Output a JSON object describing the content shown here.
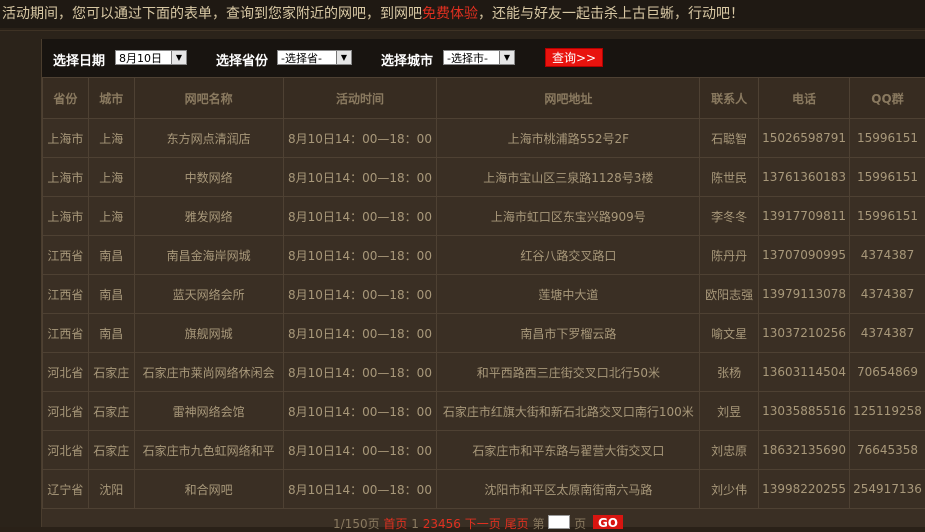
{
  "notice": {
    "before": "活动期间，您可以通过下面的表单，查询到您家附近的网吧，到网吧",
    "highlight": "免费体验",
    "after": "，还能与好友一起击杀上古巨蜥，行动吧！"
  },
  "filters": {
    "date_label": "选择日期",
    "date_value": "8月10日",
    "province_label": "选择省份",
    "province_value": "-选择省-",
    "city_label": "选择城市",
    "city_value": "-选择市-",
    "query_button": "查询>>"
  },
  "table": {
    "headers": [
      "省份",
      "城市",
      "网吧名称",
      "活动时间",
      "网吧地址",
      "联系人",
      "电话",
      "QQ群"
    ],
    "rows": [
      [
        "上海市",
        "上海",
        "东方网点清润店",
        "8月10日14：00—18：00",
        "上海市桃浦路552号2F",
        "石聪智",
        "15026598791",
        "15996151"
      ],
      [
        "上海市",
        "上海",
        "中数网络",
        "8月10日14：00—18：00",
        "上海市宝山区三泉路1128号3楼",
        "陈世民",
        "13761360183",
        "15996151"
      ],
      [
        "上海市",
        "上海",
        "雅发网络",
        "8月10日14：00—18：00",
        "上海市虹口区东宝兴路909号",
        "李冬冬",
        "13917709811",
        "15996151"
      ],
      [
        "江西省",
        "南昌",
        "南昌金海岸网城",
        "8月10日14：00—18：00",
        "红谷八路交叉路口",
        "陈丹丹",
        "13707090995",
        "4374387"
      ],
      [
        "江西省",
        "南昌",
        "蓝天网络会所",
        "8月10日14：00—18：00",
        "莲塘中大道",
        "欧阳志强",
        "13979113078",
        "4374387"
      ],
      [
        "江西省",
        "南昌",
        "旗舰网城",
        "8月10日14：00—18：00",
        "南昌市下罗榴云路",
        "喻文星",
        "13037210256",
        "4374387"
      ],
      [
        "河北省",
        "石家庄",
        "石家庄市莱尚网络休闲会",
        "8月10日14：00—18：00",
        "和平西路西三庄街交叉口北行50米",
        "张杨",
        "13603114504",
        "70654869"
      ],
      [
        "河北省",
        "石家庄",
        "雷神网络会馆",
        "8月10日14：00—18：00",
        "石家庄市红旗大街和新石北路交叉口南行100米",
        "刘昱",
        "13035885516",
        "125119258"
      ],
      [
        "河北省",
        "石家庄",
        "石家庄市九色虹网络和平",
        "8月10日14：00—18：00",
        "石家庄市和平东路与翟营大街交叉口",
        "刘忠原",
        "18632135690",
        "76645358"
      ],
      [
        "辽宁省",
        "沈阳",
        "和合网吧",
        "8月10日14：00—18：00",
        "沈阳市和平区太原南街南六马路",
        "刘少伟",
        "13998220255",
        "254917136"
      ]
    ]
  },
  "pager": {
    "summary": "1/150页",
    "first": "首页",
    "current": "1",
    "pages": [
      "2",
      "3",
      "4",
      "5",
      "6"
    ],
    "next": "下一页",
    "last": "尾页",
    "goto_prefix": "第",
    "goto_suffix": "页",
    "go_button": "GO"
  }
}
